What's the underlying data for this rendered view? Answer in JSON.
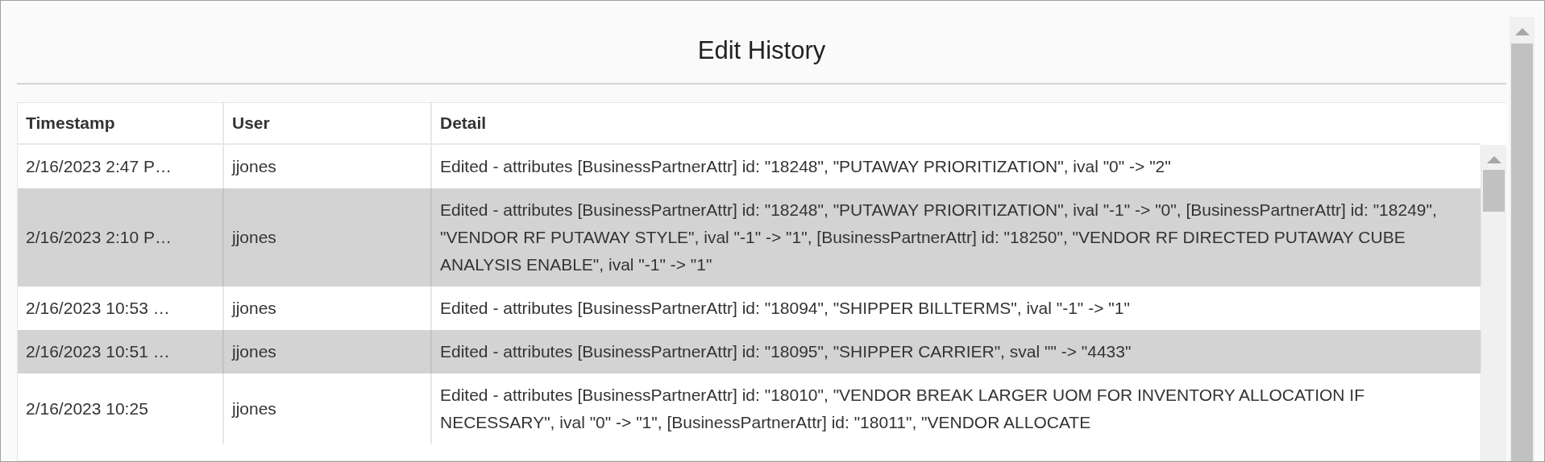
{
  "dialog": {
    "title": "Edit History"
  },
  "table": {
    "columns": [
      "Timestamp",
      "User",
      "Detail"
    ],
    "rows": [
      {
        "timestamp": "2/16/2023 2:47 P…",
        "user": "jjones",
        "detail": "Edited - attributes [BusinessPartnerAttr] id: \"18248\", \"PUTAWAY PRIORITIZATION\", ival \"0\" -> \"2\""
      },
      {
        "timestamp": "2/16/2023 2:10 P…",
        "user": "jjones",
        "detail": "Edited - attributes [BusinessPartnerAttr] id: \"18248\", \"PUTAWAY PRIORITIZATION\", ival \"-1\" -> \"0\", [BusinessPartnerAttr] id: \"18249\", \"VENDOR RF PUTAWAY STYLE\", ival \"-1\" -> \"1\", [BusinessPartnerAttr] id: \"18250\", \"VENDOR RF DIRECTED PUTAWAY CUBE ANALYSIS ENABLE\", ival \"-1\" -> \"1\""
      },
      {
        "timestamp": "2/16/2023 10:53 …",
        "user": "jjones",
        "detail": "Edited - attributes [BusinessPartnerAttr] id: \"18094\", \"SHIPPER BILLTERMS\", ival \"-1\" -> \"1\""
      },
      {
        "timestamp": "2/16/2023 10:51 …",
        "user": "jjones",
        "detail": "Edited - attributes [BusinessPartnerAttr] id: \"18095\", \"SHIPPER CARRIER\", sval \"\" -> \"4433\""
      },
      {
        "timestamp": "2/16/2023 10:25",
        "user": "jjones",
        "detail": "Edited - attributes [BusinessPartnerAttr] id: \"18010\", \"VENDOR BREAK LARGER UOM FOR INVENTORY ALLOCATION IF NECESSARY\", ival \"0\" -> \"1\", [BusinessPartnerAttr] id: \"18011\", \"VENDOR ALLOCATE"
      }
    ]
  }
}
